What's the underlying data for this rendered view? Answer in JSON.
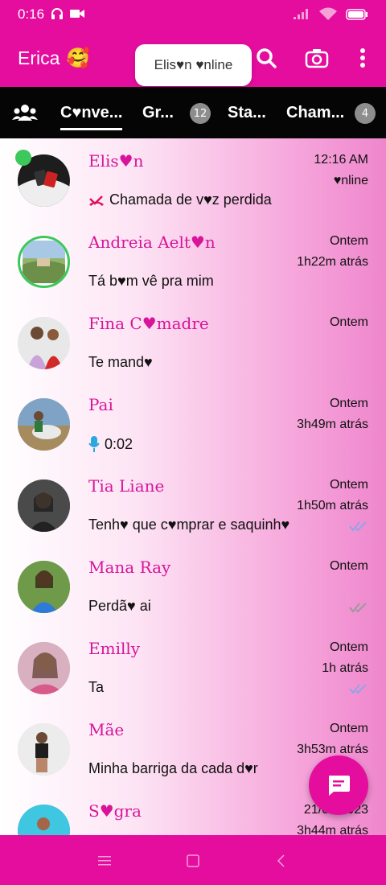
{
  "status_bar": {
    "time": "0:16"
  },
  "header": {
    "title": "Erica",
    "emoji": "🥰"
  },
  "toast": {
    "text": "Elis♥n ♥nline"
  },
  "tabs": [
    {
      "label": "C♥nve..."
    },
    {
      "label": "Gr...",
      "badge": "12"
    },
    {
      "label": "Sta..."
    },
    {
      "label": "Cham...",
      "badge": "4"
    }
  ],
  "chats": [
    {
      "name": "Elis♥n",
      "date": "12:16 AM",
      "sub": "♥nline",
      "message": "Chamada de v♥z perdida",
      "message_icon": "missed-call-icon",
      "online": true
    },
    {
      "name": "Andreia Aelt♥n",
      "date": "Ontem",
      "sub": "1h22m atrás",
      "message": "Tá b♥m vê pra mim"
    },
    {
      "name": "Fina C♥madre",
      "date": "Ontem",
      "sub": "",
      "message": "Te mand♥"
    },
    {
      "name": "Pai",
      "date": "Ontem",
      "sub": "3h49m atrás",
      "message": "0:02",
      "message_icon": "mic-icon"
    },
    {
      "name": "Tia Liane",
      "date": "Ontem",
      "sub": "1h50m atrás",
      "message": "Tenh♥ que c♥mprar e saquinh♥",
      "tick": "read"
    },
    {
      "name": "Mana Ray",
      "date": "Ontem",
      "sub": "",
      "message": "Perdã♥ ai",
      "tick": "delivered"
    },
    {
      "name": "Emilly",
      "date": "Ontem",
      "sub": "1h atrás",
      "message": "Ta",
      "tick": "read"
    },
    {
      "name": "Mãe",
      "date": "Ontem",
      "sub": "3h53m atrás",
      "message": "Minha barriga da cada d♥r"
    },
    {
      "name": "S♥gra",
      "date": "21/09/2023",
      "sub": "3h44m atrás",
      "message": ""
    }
  ],
  "colors": {
    "brand": "#e40d9e",
    "name": "#d8149a",
    "online": "#3cc85a",
    "tick_read": "#8fa4e8",
    "tick_delivered": "#9a9a9a"
  }
}
